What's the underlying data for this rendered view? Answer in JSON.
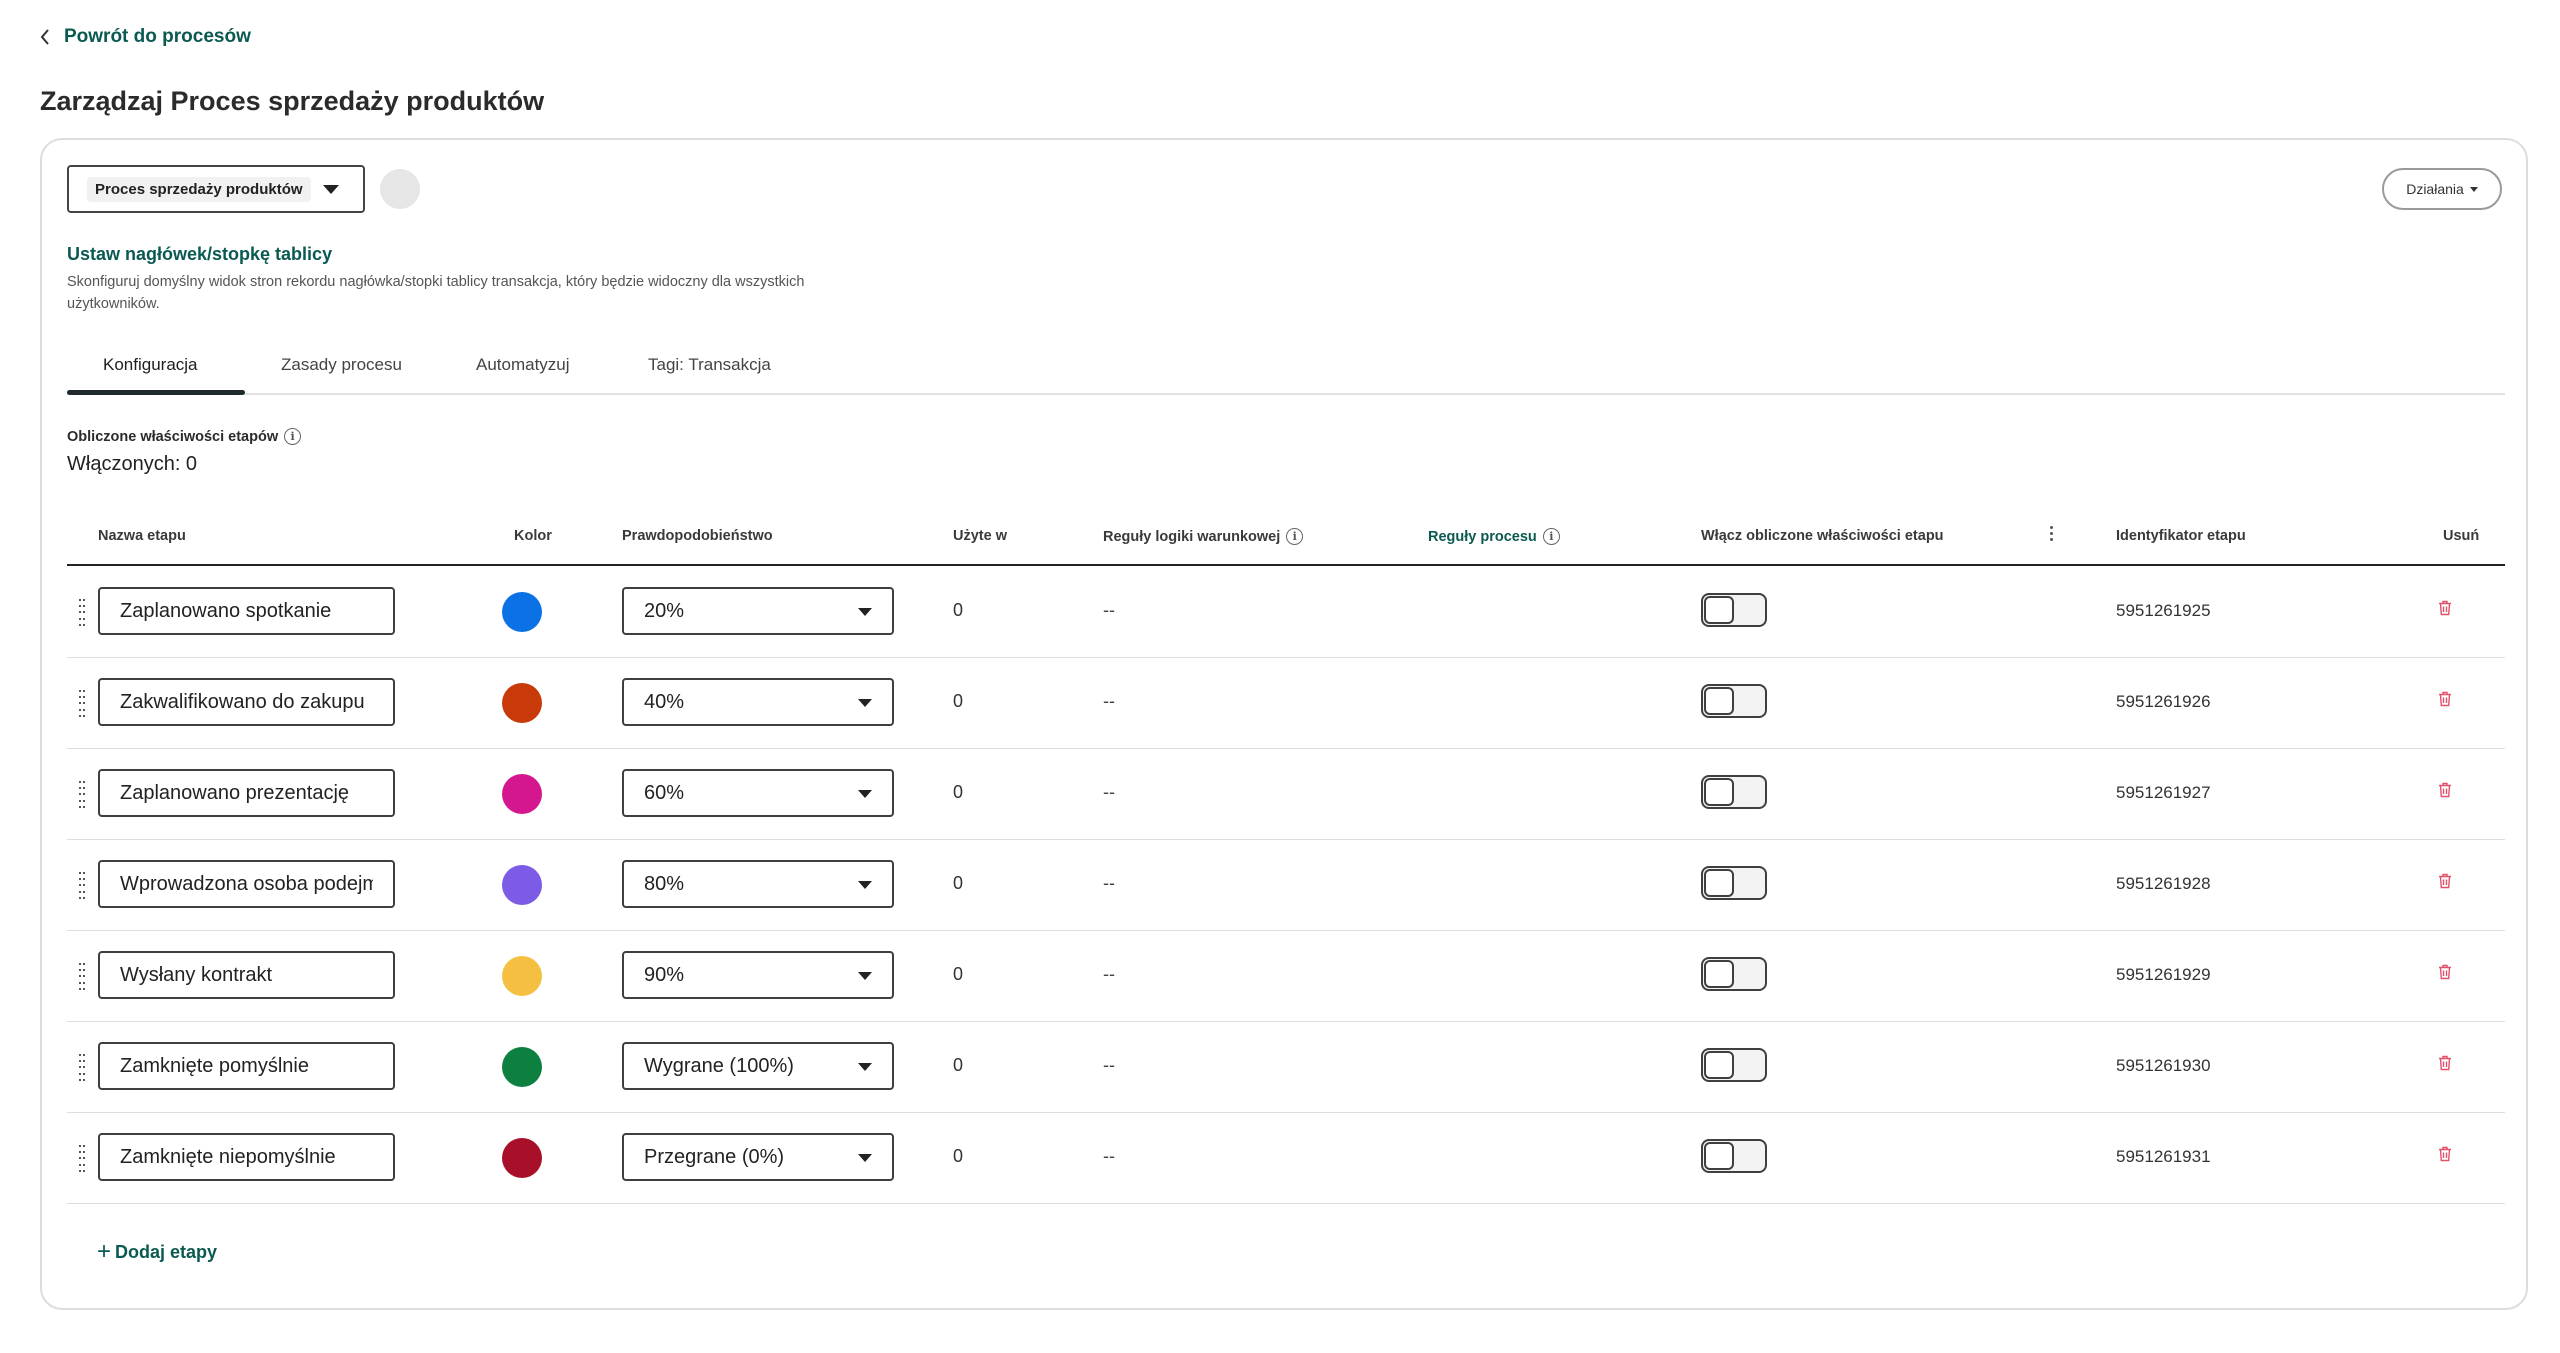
{
  "nav": {
    "back_label": "Powrót do procesów"
  },
  "page": {
    "title": "Zarządzaj Proces sprzedaży produktów"
  },
  "process_select": {
    "value": "Proces sprzedaży produktów"
  },
  "actions": {
    "label": "Działania"
  },
  "header_footer": {
    "link": "Ustaw nagłówek/stopkę tablicy",
    "description": "Skonfiguruj domyślny widok stron rekordu nagłówka/stopki tablicy transakcja, który będzie widoczny dla wszystkich użytkowników."
  },
  "tabs": [
    {
      "label": "Konfiguracja",
      "active": true
    },
    {
      "label": "Zasady procesu",
      "active": false
    },
    {
      "label": "Automatyzuj",
      "active": false
    },
    {
      "label": "Tagi: Transakcja",
      "active": false
    }
  ],
  "computed": {
    "title": "Obliczone właściwości etapów",
    "enabled_label": "Włączonych: 0"
  },
  "table": {
    "headers": {
      "name": "Nazwa etapu",
      "color": "Kolor",
      "probability": "Prawdopodobieństwo",
      "used_in": "Użyte w",
      "logic_rules": "Reguły logiki warunkowej",
      "process_rules": "Reguły procesu",
      "enable_computed": "Włącz obliczone właściwości etapu",
      "stage_id": "Identyfikator etapu",
      "delete": "Usuń"
    },
    "rows": [
      {
        "name": "Zaplanowano spotkanie",
        "color": "#0b72e6",
        "probability": "20%",
        "used_in": "0",
        "logic": "--",
        "enabled": false,
        "stage_id": "5951261925"
      },
      {
        "name": "Zakwalifikowano do zakupu",
        "color": "#c93a0a",
        "probability": "40%",
        "used_in": "0",
        "logic": "--",
        "enabled": false,
        "stage_id": "5951261926"
      },
      {
        "name": "Zaplanowano prezentację",
        "color": "#d4168f",
        "probability": "60%",
        "used_in": "0",
        "logic": "--",
        "enabled": false,
        "stage_id": "5951261927"
      },
      {
        "name": "Wprowadzona osoba podejmująca decyzję",
        "color": "#7c5ce6",
        "probability": "80%",
        "used_in": "0",
        "logic": "--",
        "enabled": false,
        "stage_id": "5951261928"
      },
      {
        "name": "Wysłany kontrakt",
        "color": "#f5bf42",
        "probability": "90%",
        "used_in": "0",
        "logic": "--",
        "enabled": false,
        "stage_id": "5951261929"
      },
      {
        "name": "Zamknięte pomyślnie",
        "color": "#0d8040",
        "probability": "Wygrane (100%)",
        "used_in": "0",
        "logic": "--",
        "enabled": false,
        "stage_id": "5951261930"
      },
      {
        "name": "Zamknięte niepomyślnie",
        "color": "#a8102a",
        "probability": "Przegrane (0%)",
        "used_in": "0",
        "logic": "--",
        "enabled": false,
        "stage_id": "5951261931"
      }
    ]
  },
  "add_stage": {
    "label": "Dodaj etapy"
  }
}
